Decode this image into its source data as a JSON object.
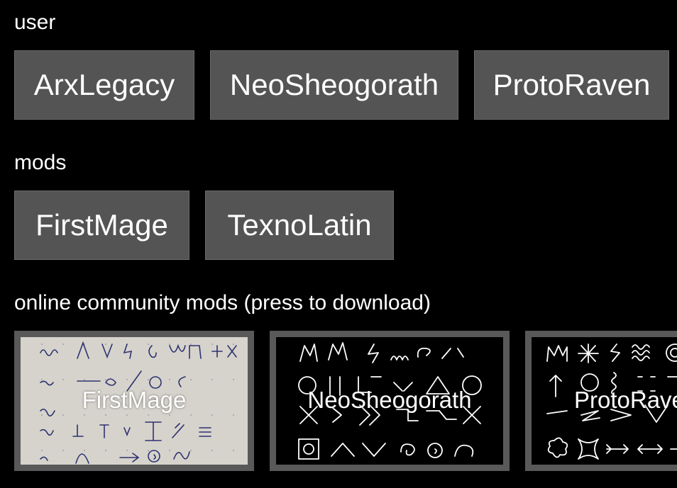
{
  "sections": {
    "user": {
      "label": "user",
      "buttons": [
        "ArxLegacy",
        "NeoSheogorath",
        "ProtoRaven"
      ]
    },
    "mods": {
      "label": "mods",
      "buttons": [
        "FirstMage",
        "TexnoLatin"
      ]
    },
    "community": {
      "label": "online community mods (press to download)",
      "cards": [
        {
          "title": "FirstMage",
          "thumbnail": "handwritten-glyph-sheet"
        },
        {
          "title": "NeoSheogorath",
          "thumbnail": "glyph-sheet-white-on-black"
        },
        {
          "title": "ProtoRaven",
          "thumbnail": "glyph-sheet-white-on-black"
        }
      ]
    }
  },
  "colors": {
    "background": "#000000",
    "button": "#545454",
    "card_frame": "#595959",
    "text": "#ffffff"
  }
}
